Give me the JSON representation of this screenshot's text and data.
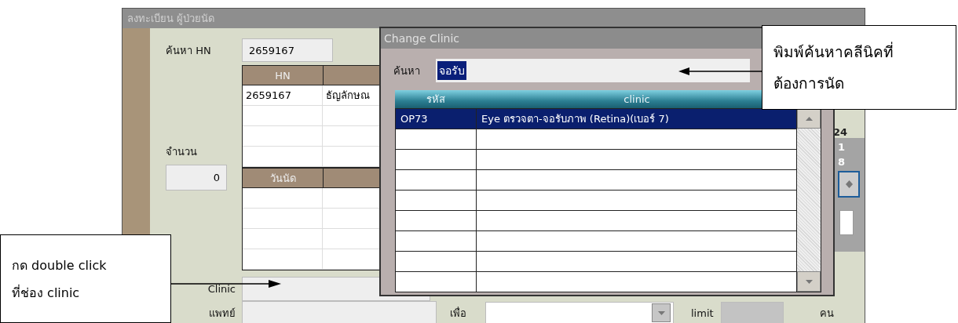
{
  "main_window": {
    "title": "ลงทะเบียน ผู้ป่วยนัด",
    "search_hn": {
      "label": "ค้นหา HN",
      "value": "2659167"
    },
    "patient_table": {
      "columns": [
        "HN"
      ],
      "rows": [
        [
          "2659167",
          "ธัญลักษณ"
        ]
      ]
    },
    "count": {
      "label": "จำนวน",
      "value": "0"
    },
    "appointment_table": {
      "columns": [
        "วันนัด"
      ]
    },
    "clinic": {
      "label": "Clinic"
    },
    "doctor": {
      "label": "แพทย์"
    },
    "purpose": {
      "label": "เพื่อ"
    },
    "limit": {
      "label": "limit",
      "unit": "คน"
    },
    "side_panel": {
      "total": "24",
      "numbers": [
        "1",
        "8"
      ]
    }
  },
  "dialog": {
    "title": "Change Clinic",
    "search": {
      "label": "ค้นหา",
      "value": "จอรับ"
    },
    "columns": [
      "รหัส",
      "clinic"
    ],
    "rows": [
      {
        "code": "OP73",
        "clinic": "Eye ตรวจตา-จอรับภาพ (Retina)(เบอร์ 7)",
        "selected": true
      }
    ]
  },
  "callouts": [
    {
      "lines": [
        "พิมพ์ค้นหาคลีนิคที่",
        "ต้องการนัด"
      ]
    },
    {
      "lines": [
        "กด double click",
        "ที่ช่อง clinic"
      ]
    }
  ]
}
